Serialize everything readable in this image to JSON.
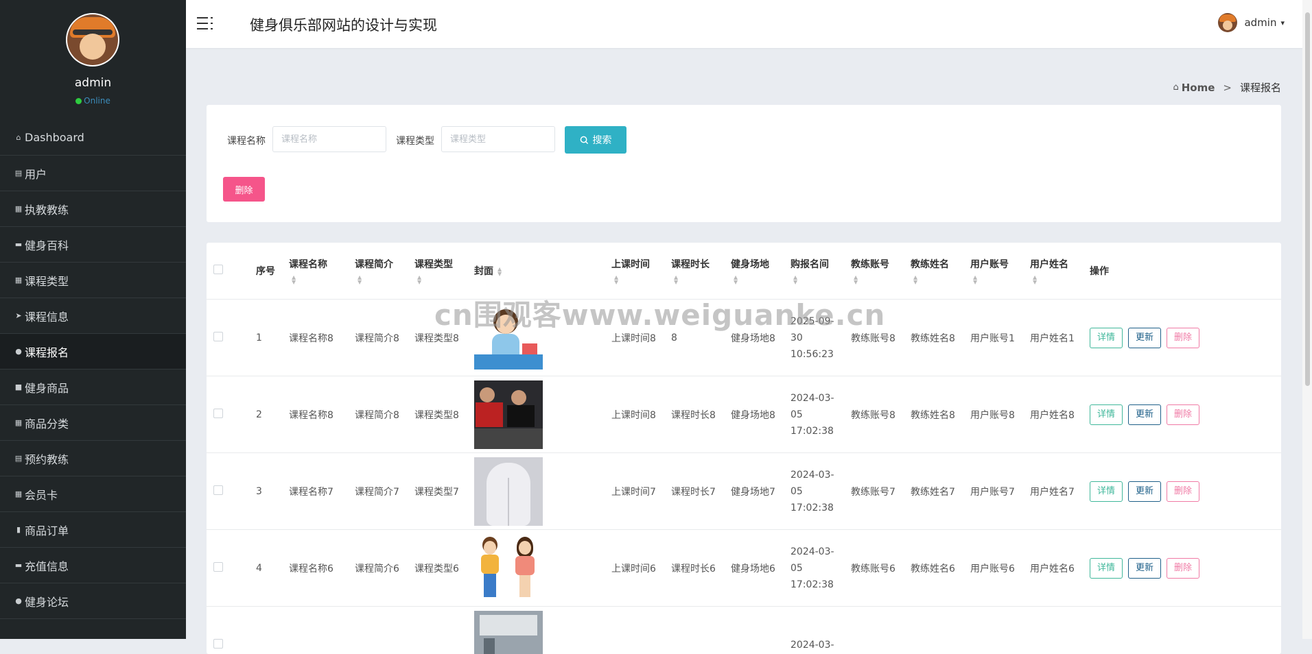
{
  "app": {
    "title": "健身俱乐部网站的设计与实现"
  },
  "user": {
    "name": "admin",
    "status": "Online"
  },
  "sidebar": {
    "items": [
      {
        "label": "Dashboard",
        "icon": "home-icon",
        "glyph": "⌂"
      },
      {
        "label": "用户",
        "icon": "clipboard-icon",
        "glyph": "▤"
      },
      {
        "label": "执教教练",
        "icon": "grid-icon",
        "glyph": "▦"
      },
      {
        "label": "健身百科",
        "icon": "briefcase-icon",
        "glyph": "▬"
      },
      {
        "label": "课程类型",
        "icon": "grid-icon",
        "glyph": "▦"
      },
      {
        "label": "课程信息",
        "icon": "paper-plane-icon",
        "glyph": "➤"
      },
      {
        "label": "课程报名",
        "icon": "map-marker-icon",
        "glyph": "●",
        "active": true
      },
      {
        "label": "健身商品",
        "icon": "video-icon",
        "glyph": "■"
      },
      {
        "label": "商品分类",
        "icon": "grid-icon",
        "glyph": "▦"
      },
      {
        "label": "预约教练",
        "icon": "file-icon",
        "glyph": "▤"
      },
      {
        "label": "会员卡",
        "icon": "calendar-grid-icon",
        "glyph": "▦"
      },
      {
        "label": "商品订单",
        "icon": "bar-chart-icon",
        "glyph": "▮"
      },
      {
        "label": "充值信息",
        "icon": "comment-icon",
        "glyph": "▬"
      },
      {
        "label": "健身论坛",
        "icon": "user-icon",
        "glyph": "●"
      }
    ]
  },
  "breadcrumb": {
    "home": "Home",
    "separator": ">",
    "current": "课程报名"
  },
  "search": {
    "name_label": "课程名称",
    "name_placeholder": "课程名称",
    "type_label": "课程类型",
    "type_placeholder": "课程类型",
    "button_label": "搜索",
    "delete_label": "删除"
  },
  "table": {
    "columns": [
      "序号",
      "课程名称",
      "课程简介",
      "课程类型",
      "封面",
      "上课时间",
      "课程时长",
      "健身场地",
      "购报名间",
      "教练账号",
      "教练姓名",
      "用户账号",
      "用户姓名",
      "操作"
    ],
    "actions": {
      "detail": "详情",
      "update": "更新",
      "remove": "删除"
    },
    "rows": [
      {
        "no": "1",
        "name": "课程名称8",
        "intro": "课程简介8",
        "type": "课程类型8",
        "cover": "cartoon-girl-at-desk",
        "time": "上课时间8",
        "duration": "8",
        "venue": "健身场地8",
        "signup": "2025-09-30 10:56:23",
        "coach_acct": "教练账号8",
        "coach_name": "教练姓名8",
        "user_acct": "用户账号1",
        "user_name": "用户姓名1"
      },
      {
        "no": "2",
        "name": "课程名称8",
        "intro": "课程简介8",
        "type": "课程类型8",
        "cover": "spin-class-photo",
        "time": "上课时间8",
        "duration": "课程时长8",
        "venue": "健身场地8",
        "signup": "2024-03-05 17:02:38",
        "coach_acct": "教练账号8",
        "coach_name": "教练姓名8",
        "user_acct": "用户账号8",
        "user_name": "用户姓名8"
      },
      {
        "no": "3",
        "name": "课程名称7",
        "intro": "课程简介7",
        "type": "课程类型7",
        "cover": "leggings-photo",
        "time": "上课时间7",
        "duration": "课程时长7",
        "venue": "健身场地7",
        "signup": "2024-03-05 17:02:38",
        "coach_acct": "教练账号7",
        "coach_name": "教练姓名7",
        "user_acct": "用户账号7",
        "user_name": "用户姓名7"
      },
      {
        "no": "4",
        "name": "课程名称6",
        "intro": "课程简介6",
        "type": "课程类型6",
        "cover": "cartoon-couple",
        "time": "上课时间6",
        "duration": "课程时长6",
        "venue": "健身场地6",
        "signup": "2024-03-05 17:02:38",
        "coach_acct": "教练账号6",
        "coach_name": "教练姓名6",
        "user_acct": "用户账号6",
        "user_name": "用户姓名6"
      },
      {
        "no": "",
        "name": "",
        "intro": "",
        "type": "",
        "cover": "gym-interior-photo",
        "time": "",
        "duration": "",
        "venue": "",
        "signup": "2024-03-",
        "coach_acct": "",
        "coach_name": "",
        "user_acct": "",
        "user_name": ""
      }
    ]
  },
  "watermark": "cn围观客www.weiguanke.cn",
  "colors": {
    "sidebar_bg": "#212628",
    "search_button": "#2fb1c5",
    "delete_button": "#f5558a",
    "detail": "#3fb79a",
    "update": "#1d5f88",
    "remove": "#f07aa5"
  }
}
